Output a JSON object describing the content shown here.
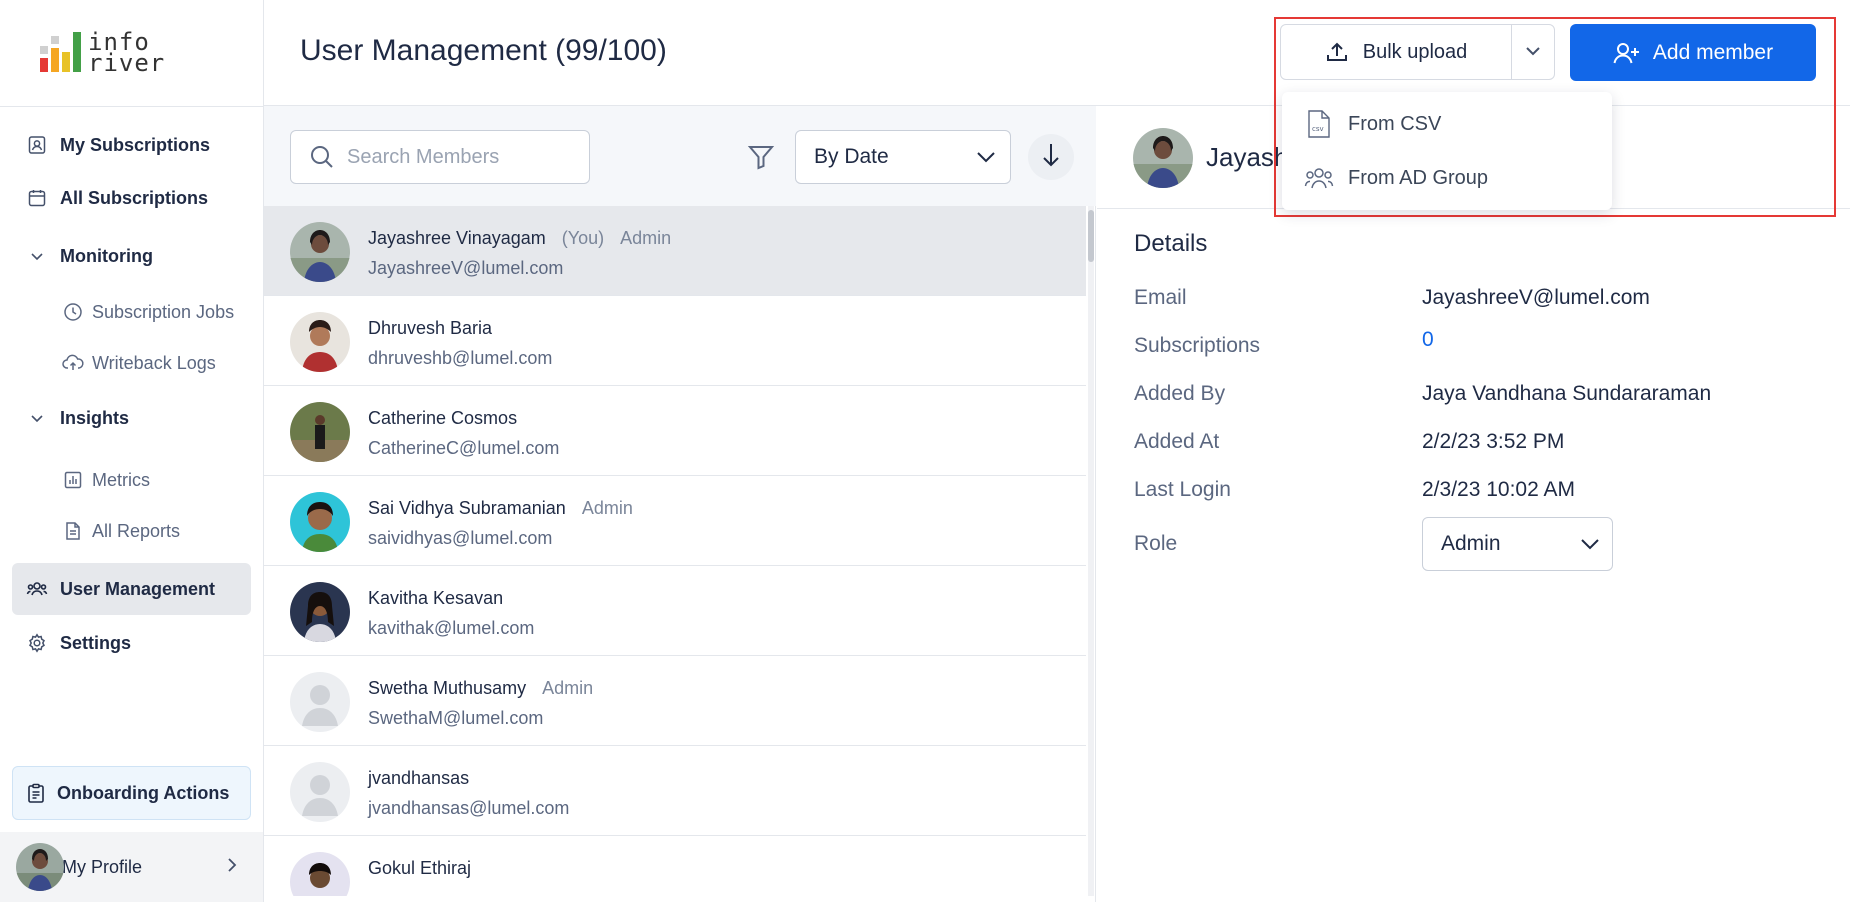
{
  "brand": {
    "logo_text_line1": "info",
    "logo_text_line2": "river"
  },
  "sidebar": {
    "items": [
      {
        "label": "My Subscriptions",
        "icon": "user-card-icon"
      },
      {
        "label": "All Subscriptions",
        "icon": "calendar-icon"
      }
    ],
    "monitoring": {
      "label": "Monitoring",
      "children": [
        {
          "label": "Subscription Jobs",
          "icon": "clock-icon"
        },
        {
          "label": "Writeback Logs",
          "icon": "cloud-upload-icon"
        }
      ]
    },
    "insights": {
      "label": "Insights",
      "children": [
        {
          "label": "Metrics",
          "icon": "bar-chart-icon"
        },
        {
          "label": "All Reports",
          "icon": "document-icon"
        }
      ]
    },
    "user_management": "User Management",
    "settings": "Settings",
    "onboarding": "Onboarding Actions",
    "profile": "My Profile"
  },
  "header": {
    "title": "User Management (99/100)",
    "bulk_upload": "Bulk upload",
    "add_member": "Add member",
    "bulk_menu": [
      "From CSV",
      "From AD Group"
    ]
  },
  "list": {
    "search_placeholder": "Search Members",
    "sort_value": "By Date",
    "members": [
      {
        "name": "Jayashree Vinayagam",
        "you": "(You)",
        "role": "Admin",
        "email": "JayashreeV@lumel.com",
        "avatar": "photo"
      },
      {
        "name": "Dhruvesh Baria",
        "you": "",
        "role": "",
        "email": "dhruveshb@lumel.com",
        "avatar": "photo"
      },
      {
        "name": "Catherine Cosmos",
        "you": "",
        "role": "",
        "email": "CatherineC@lumel.com",
        "avatar": "photo"
      },
      {
        "name": "Sai Vidhya Subramanian",
        "you": "",
        "role": "Admin",
        "email": "saividhyas@lumel.com",
        "avatar": "photo"
      },
      {
        "name": "Kavitha Kesavan",
        "you": "",
        "role": "",
        "email": "kavithak@lumel.com",
        "avatar": "photo"
      },
      {
        "name": "Swetha Muthusamy",
        "you": "",
        "role": "Admin",
        "email": "SwethaM@lumel.com",
        "avatar": "placeholder"
      },
      {
        "name": "jvandhansas",
        "you": "",
        "role": "",
        "email": "jvandhansas@lumel.com",
        "avatar": "placeholder"
      },
      {
        "name": "Gokul Ethiraj",
        "you": "",
        "role": "",
        "email": "",
        "avatar": "photo"
      }
    ]
  },
  "details": {
    "name": "Jayashree Vinayagam",
    "title": "Details",
    "fields": [
      {
        "label": "Email",
        "value": "JayashreeV@lumel.com"
      },
      {
        "label": "Subscriptions",
        "value": "0"
      },
      {
        "label": "Added By",
        "value": "Jaya Vandhana Sundararaman"
      },
      {
        "label": "Added At",
        "value": "2/2/23 3:52 PM"
      },
      {
        "label": "Last Login",
        "value": "2/3/23 10:02 AM"
      }
    ],
    "role_label": "Role",
    "role_value": "Admin"
  },
  "colors": {
    "accent": "#1267e8",
    "highlight": "#e53935",
    "text": "#1f2a44",
    "muted": "#5b6780"
  }
}
